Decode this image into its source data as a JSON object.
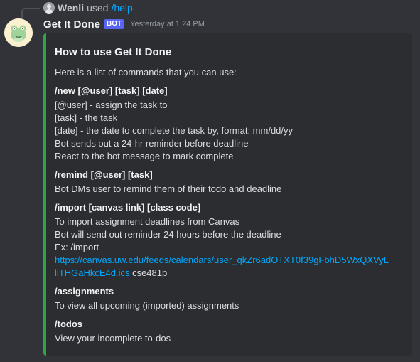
{
  "reply": {
    "username": "Wenli",
    "used_text": "used",
    "command": "/help"
  },
  "message": {
    "author": "Get It Done",
    "badge": "BOT",
    "timestamp": "Yesterday at 1:24 PM"
  },
  "embed": {
    "accent_color": "#2ca843",
    "title": "How to use Get It Done",
    "intro": "Here is a list of commands that you can use:",
    "new": {
      "name": "/new [@user] [task] [date]",
      "lines": [
        "[@user] - assign the task to",
        "[task] - the task",
        "[date] - the date to complete the task by, format: mm/dd/yy",
        "Bot sends out a 24-hr reminder before deadline",
        "React to the bot message to mark complete"
      ]
    },
    "remind": {
      "name": "/remind [@user] [task]",
      "lines": [
        "Bot DMs user to remind them of their todo and deadline"
      ]
    },
    "import": {
      "name": "/import [canvas link] [class code]",
      "lines": [
        "To import assignment deadlines from Canvas",
        "Bot will send out reminder 24 hours before the deadline",
        "Ex: /import"
      ],
      "link_line1": "https://canvas.uw.edu/feeds/calendars/user_qkZr6adOTXT0f39gFbhD5WxQXVyL",
      "link_line2": "liTHGaHkcE4d.ics",
      "class_code": " cse481p"
    },
    "assignments": {
      "name": "/assignments",
      "lines": [
        "To view all upcoming (imported) assignments"
      ]
    },
    "todos": {
      "name": "/todos",
      "lines": [
        "View your incomplete to-dos"
      ]
    }
  }
}
